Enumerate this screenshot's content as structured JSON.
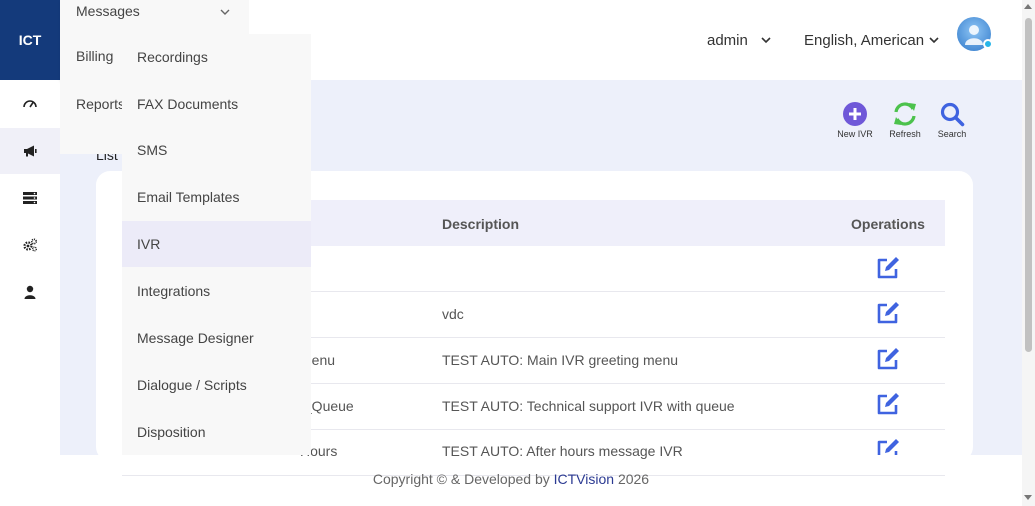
{
  "brand": {
    "label": "ICT"
  },
  "rail": {
    "items": [
      {
        "icon": "dashboard-gauge-icon"
      },
      {
        "icon": "megaphone-icon",
        "active": true
      },
      {
        "icon": "server-list-icon"
      },
      {
        "icon": "cogs-icon"
      },
      {
        "icon": "user-icon"
      }
    ]
  },
  "header": {
    "user": "admin",
    "language": "English, American"
  },
  "menu": {
    "top_label": "Messages",
    "side_items": [
      "Billing",
      "Reports"
    ],
    "sub_items": [
      {
        "label": "Recordings"
      },
      {
        "label": "FAX Documents"
      },
      {
        "label": "SMS"
      },
      {
        "label": "Email Templates"
      },
      {
        "label": "IVR",
        "active": true
      },
      {
        "label": "Integrations"
      },
      {
        "label": "Message Designer"
      },
      {
        "label": "Dialogue / Scripts"
      },
      {
        "label": "Disposition"
      }
    ]
  },
  "page": {
    "list_label": "List"
  },
  "toolbar": {
    "new_ivr": "New IVR",
    "refresh": "Refresh",
    "search": "Search"
  },
  "table": {
    "headers": {
      "description": "Description",
      "operations": "Operations"
    },
    "rows": [
      {
        "name": "",
        "description": ""
      },
      {
        "name": "",
        "description": "vdc"
      },
      {
        "name": "Menu",
        "description": "TEST AUTO: Main IVR greeting menu"
      },
      {
        "name": "t_Queue",
        "description": "TEST AUTO: Technical support IVR with queue"
      },
      {
        "name": "Hours",
        "description": "TEST AUTO: After hours message IVR"
      }
    ]
  },
  "footer": {
    "prefix": "Copyright © & Developed by",
    "brand": "ICTVision",
    "year": "2026"
  },
  "colors": {
    "brand_bg": "#143a7b",
    "accent": "#3f63e0",
    "add_purple": "#6f58d8",
    "refresh_green": "#4cc24c"
  }
}
